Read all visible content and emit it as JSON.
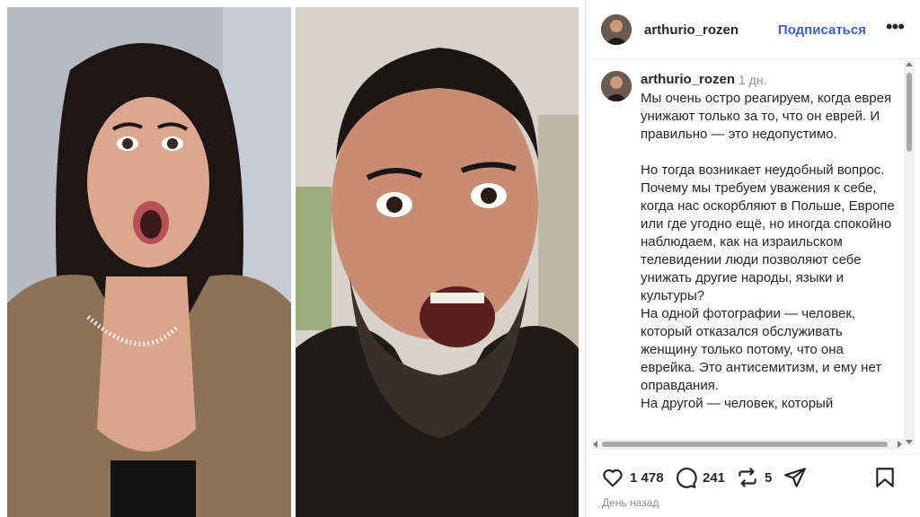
{
  "post": {
    "username": "arthurio_rozen",
    "follow_label": "Подписаться",
    "more_label": "•••"
  },
  "caption": {
    "username": "arthurio_rozen",
    "time": "1 дн.",
    "text": "Мы очень остро реагируем, когда еврея унижают только за то, что он еврей. И правильно — это недопустимо.\n\nНо тогда возникает неудобный вопрос.\nПочему мы требуем уважения к себе, когда нас оскорбляют в Польше, Европе или где угодно ещё, но иногда спокойно наблюдаем, как на израильском телевидении люди позволяют себе унижать другие народы, языки и культуры?\nНа одной фотографии — человек, который отказался обслуживать женщину только потому, что она еврейка. Это антисемитизм, и ему нет оправдания.\nНа другой — человек, который"
  },
  "actions": {
    "like_icon": "heart-icon",
    "likes": "1 478",
    "comment_icon": "comment-icon",
    "comments": "241",
    "repost_icon": "repost-icon",
    "reposts": "5",
    "share_icon": "share-icon",
    "save_icon": "bookmark-icon"
  },
  "date": "День назад",
  "colors": {
    "follow": "#3f5ed6",
    "muted": "#8e8e8e",
    "text": "#262626"
  }
}
